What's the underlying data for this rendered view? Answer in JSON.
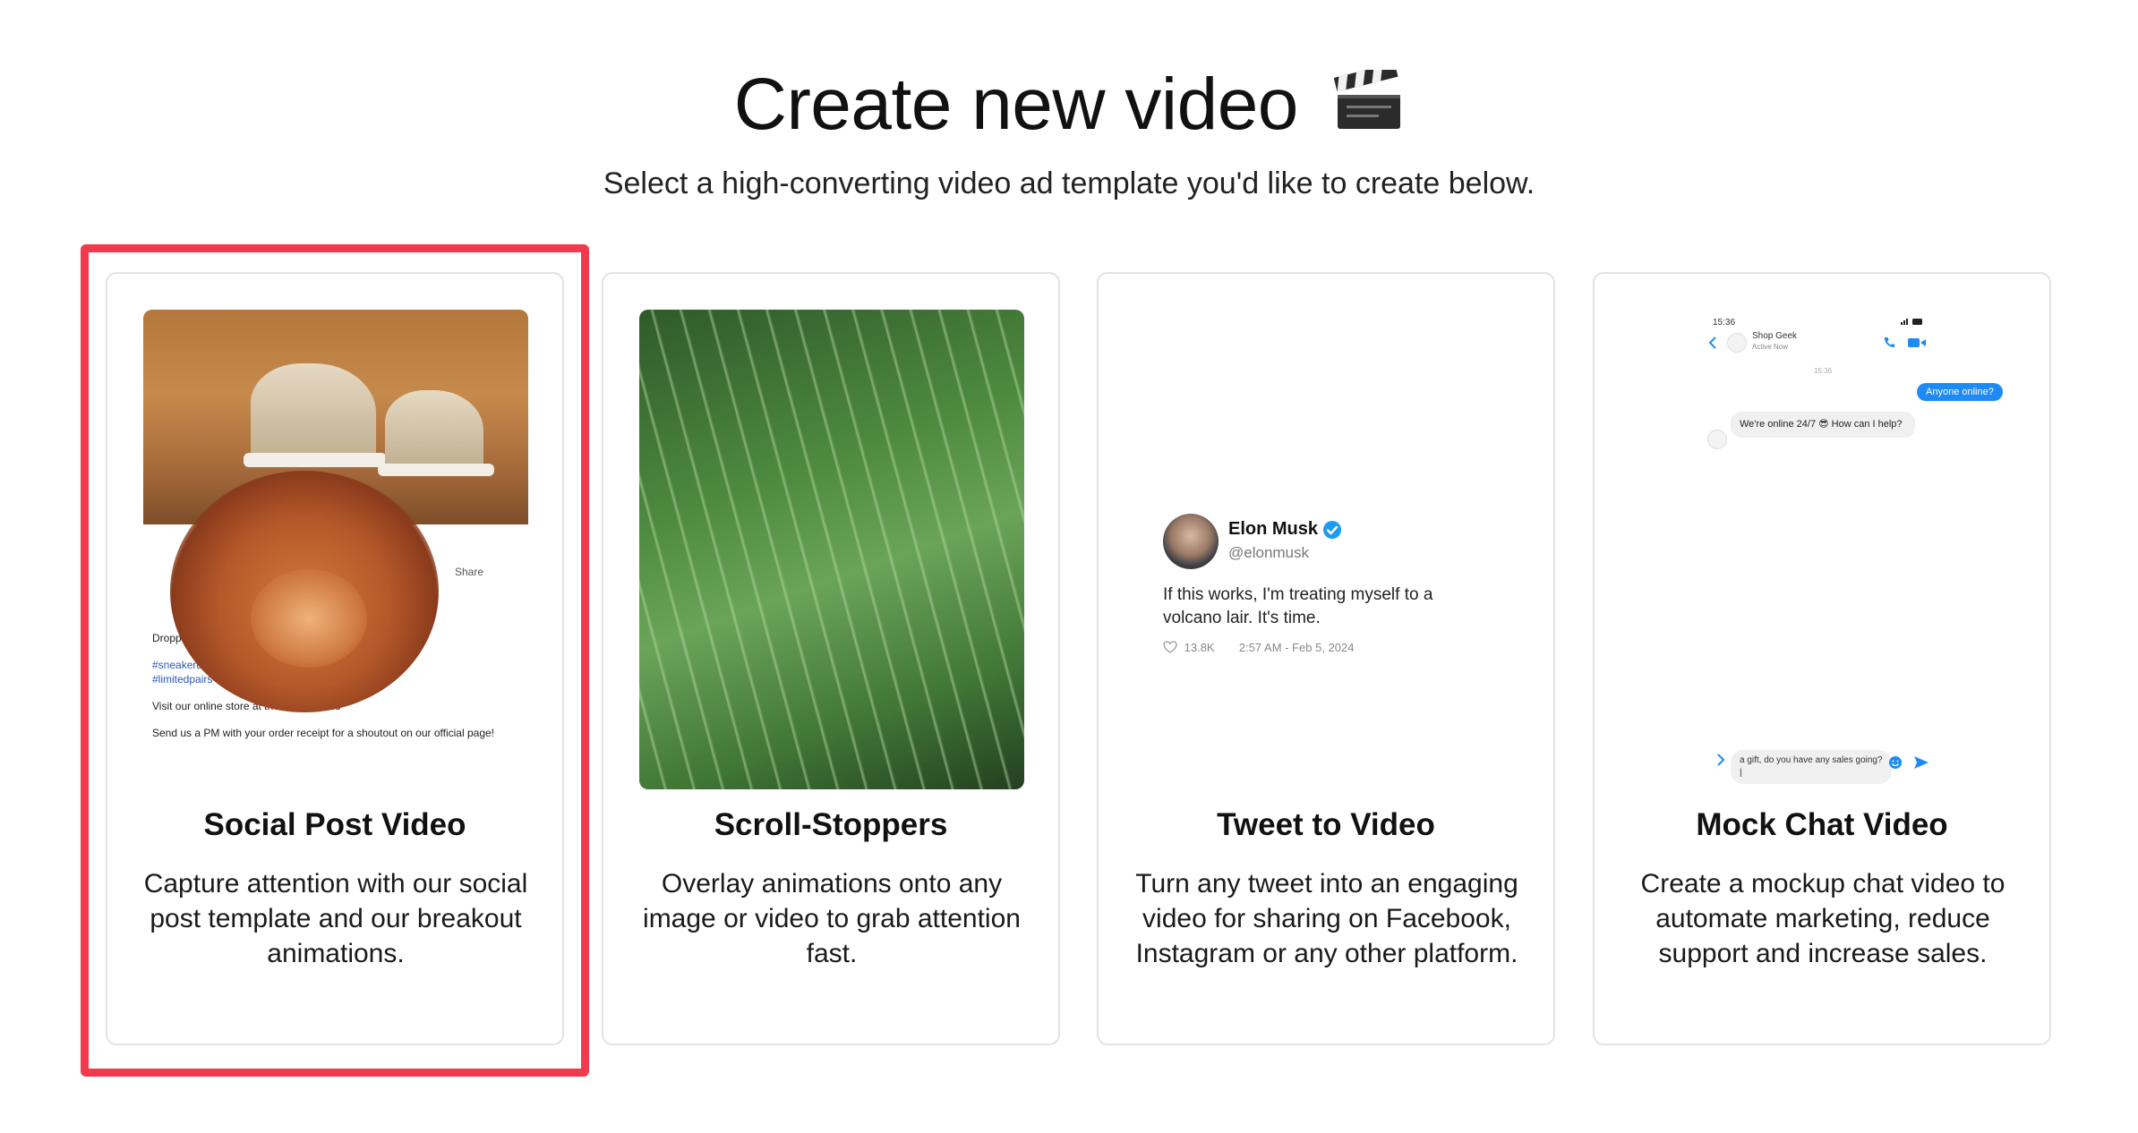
{
  "header": {
    "title": "Create new video",
    "title_icon": "clapperboard-icon",
    "subtitle": "Select a high-converting video ad template you'd like to create below."
  },
  "colors": {
    "highlight_border": "#f23a4c",
    "card_border": "#e3e3e3",
    "chat_blue": "#1e8bf5",
    "link_blue": "#2a56b7",
    "verified_blue": "#1d9bf0"
  },
  "cards": [
    {
      "title": "Social Post Video",
      "description": "Capture attention with our social post template and our breakout animations.",
      "selected": true,
      "preview": {
        "share_label": "Share",
        "post_lines": [
          "Dropping at mi",
          "#sneakerdrop",
          "#limitedpairs",
          "Visit our online store at the clock strikes",
          "Send us a PM with your order receipt for a shoutout on our official page!"
        ]
      }
    },
    {
      "title": "Scroll-Stoppers",
      "description": "Overlay animations onto any image or video to grab attention fast."
    },
    {
      "title": "Tweet to Video",
      "description": "Turn any tweet into an engaging video for sharing on Facebook, Instagram or any other platform.",
      "preview": {
        "name": "Elon Musk",
        "handle": "@elonmusk",
        "text": "If this works, I'm treating myself to a volcano lair. It's time.",
        "likes": "13.8K",
        "timestamp": "2:57 AM - Feb 5, 2024"
      }
    },
    {
      "title": "Mock Chat Video",
      "description": "Create a mockup chat video to automate marketing, reduce support and increase sales.",
      "preview": {
        "status_time": "15:36",
        "contact_name": "Shop Geek",
        "contact_status": "Active Now",
        "chat_time": "15:36",
        "user_message": "Anyone online?",
        "reply_message": "We're online 24/7 😎 How can I help?",
        "input_text": "a gift, do you have any sales going?|"
      }
    }
  ]
}
